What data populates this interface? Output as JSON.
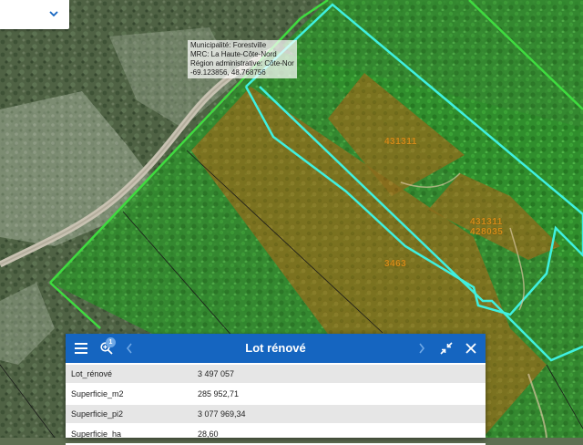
{
  "tooltip": {
    "municipality": "Municipalité: Forestville",
    "mrc": "MRC: La Haute-Côte-Nord",
    "region": "Région administrative: Côte-Nord",
    "coords": "-69.123856, 48.768756"
  },
  "lots": [
    {
      "number": "431311"
    },
    {
      "number": "431311"
    },
    {
      "number": "428035"
    },
    {
      "number": "3463"
    }
  ],
  "popup": {
    "title": "Lot rénové",
    "zoom_badge": "1",
    "rows": [
      {
        "key": "Lot_rénové",
        "value": "3 497 057"
      },
      {
        "key": "Superficie_m2",
        "value": "285 952,71"
      },
      {
        "key": "Superficie_pi2",
        "value": "3 077 969,34"
      },
      {
        "key": "Superficie_ha",
        "value": "28,60"
      }
    ]
  },
  "colors": {
    "header_blue": "#1565c0",
    "lot_outline_green": "#3fdc3f",
    "selected_outline_cyan": "#3ff0e0",
    "lot_fill_green": "#3aa83a",
    "lot_fill_brown": "#9a7a1e",
    "lot_label_orange": "#d28d1c"
  },
  "icons": [
    "chevron-down-icon",
    "menu-icon",
    "zoom-in-icon",
    "chevron-left-icon",
    "chevron-right-icon",
    "collapse-icon",
    "close-icon"
  ]
}
